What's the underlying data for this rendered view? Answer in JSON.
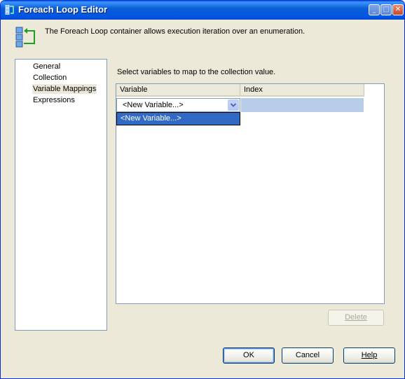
{
  "window": {
    "title": "Foreach Loop Editor",
    "controls": {
      "minimize": "_",
      "maximize": "□",
      "close": "✕"
    }
  },
  "header": {
    "description": "The Foreach Loop container allows execution iteration over an enumeration."
  },
  "nav": {
    "items": [
      {
        "label": "General",
        "selected": false
      },
      {
        "label": "Collection",
        "selected": false
      },
      {
        "label": "Variable Mappings",
        "selected": true
      },
      {
        "label": "Expressions",
        "selected": false
      }
    ]
  },
  "mappings": {
    "instruction": "Select variables to map to the collection value.",
    "columns": [
      "Variable",
      "Index"
    ],
    "rows": [
      {
        "variable": "<New Variable...>",
        "index": ""
      }
    ],
    "dropdown_options": [
      "<New Variable...>"
    ]
  },
  "buttons": {
    "delete": "Delete",
    "ok": "OK",
    "cancel": "Cancel",
    "help": "Help"
  },
  "colors": {
    "titlebar": "#0054e3",
    "dialog_bg": "#ece9d8",
    "selection": "#316ac5",
    "index_cell": "#b8cde8"
  },
  "icons": [
    "foreach-loop-icon",
    "minimize-icon",
    "maximize-icon",
    "close-icon",
    "dropdown-arrow-icon"
  ]
}
